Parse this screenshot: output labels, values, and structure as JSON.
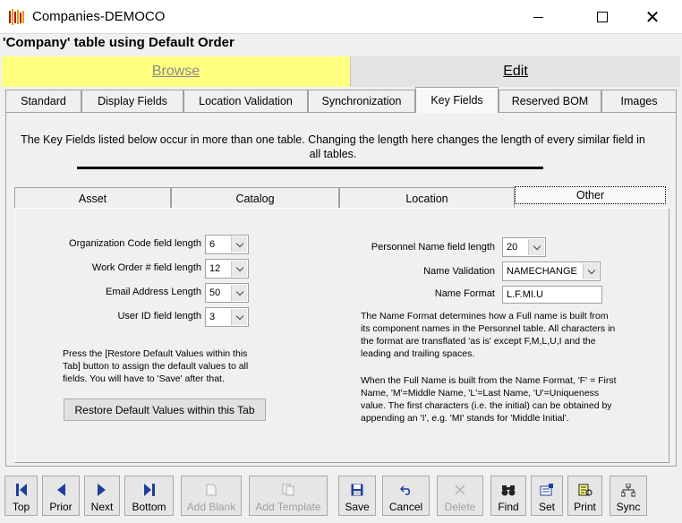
{
  "window": {
    "title": "Companies-DEMOCO"
  },
  "form": {
    "heading": "'Company' table using Default Order"
  },
  "modes": {
    "browse": "Browse",
    "edit": "Edit"
  },
  "tabs": [
    "Standard",
    "Display Fields",
    "Location Validation",
    "Synchronization",
    "Key Fields",
    "Reserved BOM",
    "Images"
  ],
  "active_tab": "Key Fields",
  "key_fields": {
    "info": "The Key Fields listed below occur in more than one table. Changing the length here changes the length of every similar field in all tables.",
    "subtabs": [
      "Asset",
      "Catalog",
      "Location",
      "Other"
    ],
    "active_subtab": "Other",
    "left_fields": [
      {
        "label": "Organization Code field length",
        "value": "6"
      },
      {
        "label": "Work Order # field length",
        "value": "12"
      },
      {
        "label": "Email Address Length",
        "value": "50"
      },
      {
        "label": "User ID field length",
        "value": "3"
      }
    ],
    "restore_note": "Press the [Restore Default Values within this Tab] button to assign the default values to all fields. You will have to 'Save' after that.",
    "restore_button": "Restore Default Values within this Tab",
    "personnel_name_length": {
      "label": "Personnel Name field length",
      "value": "20"
    },
    "name_validation": {
      "label": "Name Validation",
      "value": "NAMECHANGE"
    },
    "name_format": {
      "label": "Name Format",
      "value": "L.F.MI.U"
    },
    "name_format_note_1": "The Name Format determines how a Full name is built from its component names in the Personnel table. All characters in the format are transflated 'as is' except F,M,L,U,I and the leading and trailing spaces.",
    "name_format_note_2": "When the Full Name is built from the Name Format, 'F' = First Name, 'M'=Middle Name, 'L'=Last Name, 'U'=Uniqueness value. The first characters (i.e. the initial) can be obtained by appending an 'I', e.g. 'MI' stands for 'Middle Initial'."
  },
  "toolbar": [
    {
      "label": "Top",
      "icon": "first-record-icon",
      "enabled": true
    },
    {
      "label": "Prior",
      "icon": "prior-record-icon",
      "enabled": true
    },
    {
      "label": "Next",
      "icon": "next-record-icon",
      "enabled": true
    },
    {
      "label": "Bottom",
      "icon": "last-record-icon",
      "enabled": true
    },
    {
      "label": "Add Blank",
      "icon": "new-document-icon",
      "enabled": false
    },
    {
      "label": "Add Template",
      "icon": "copy-document-icon",
      "enabled": false
    },
    {
      "label": "Save",
      "icon": "floppy-disk-icon",
      "enabled": true
    },
    {
      "label": "Cancel",
      "icon": "undo-icon",
      "enabled": true
    },
    {
      "label": "Delete",
      "icon": "delete-x-icon",
      "enabled": false
    },
    {
      "label": "Find",
      "icon": "binoculars-icon",
      "enabled": true
    },
    {
      "label": "Set",
      "icon": "filter-set-icon",
      "enabled": true
    },
    {
      "label": "Print",
      "icon": "printer-icon",
      "enabled": true
    },
    {
      "label": "Sync",
      "icon": "network-sync-icon",
      "enabled": true
    }
  ],
  "colors": {
    "browse_bg": "#ffff80",
    "accent_blue": "#1c3f9e"
  }
}
